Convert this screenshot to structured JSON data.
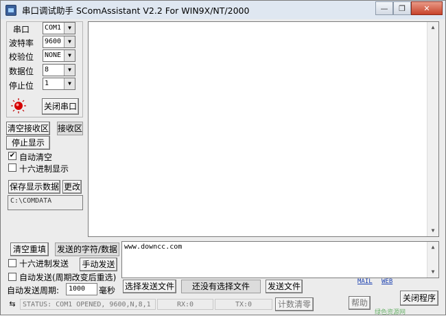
{
  "window": {
    "title": "串口调试助手 SComAssistant V2.2 For WIN9X/NT/2000",
    "minimize": "—",
    "restore": "❐",
    "close": "✕"
  },
  "settings": {
    "port_label": "串口",
    "port_value": "COM1",
    "baud_label": "波特率",
    "baud_value": "9600",
    "parity_label": "校验位",
    "parity_value": "NONE",
    "databits_label": "数据位",
    "databits_value": "8",
    "stopbits_label": "停止位",
    "stopbits_value": "1",
    "close_port_button": "关闭串口"
  },
  "receive": {
    "clear_button": "清空接收区",
    "area_label": "接收区",
    "stop_display_button": "停止显示",
    "auto_clear_label": "自动清空",
    "auto_clear_checked": true,
    "hex_display_label": "十六进制显示",
    "hex_display_checked": false,
    "save_data_button": "保存显示数据",
    "change_button": "更改",
    "save_path": "C:\\COMDATA"
  },
  "send": {
    "clear_button": "清空重填",
    "chars_label": "发送的字符/数据",
    "hex_send_label": "十六进制发送",
    "hex_send_checked": false,
    "manual_send_button": "手动发送",
    "auto_send_label": "自动发送(周期改变后重选)",
    "auto_send_checked": false,
    "period_label": "自动发送周期:",
    "period_value": "1000",
    "period_unit": "毫秒",
    "text": "www.downcc.com",
    "select_file_button": "选择发送文件",
    "no_file_label": "还没有选择文件",
    "send_file_button": "发送文件"
  },
  "footer": {
    "status_text": "STATUS: COM1 OPENED, 9600,N,8,1",
    "rx_text": "RX:0",
    "tx_text": "TX:0",
    "reset_count_button": "计数清零",
    "help_button": "帮助",
    "close_program_button": "关闭程序",
    "mail_link": "MAIL",
    "web_link": "WEB",
    "watermark": "绿色资源网"
  }
}
